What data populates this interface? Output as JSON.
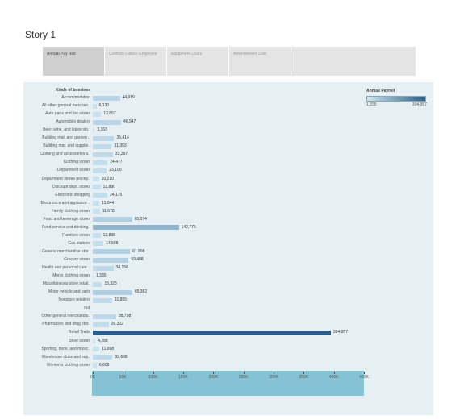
{
  "story_title": "Story 1",
  "tabs": [
    {
      "label": "Annual Pay Roll",
      "active": true
    },
    {
      "label": "Contract Labour Employee",
      "active": false
    },
    {
      "label": "Equipment Costs",
      "active": false
    },
    {
      "label": "Advertisment Cost",
      "active": false
    }
  ],
  "colors": {
    "low": "#cce4f2",
    "high": "#2b5e88",
    "axis_band": "#85c3d4",
    "viz_bg": "#e6eff4"
  },
  "legend": {
    "title": "Annual Payroll",
    "min_label": "1,335",
    "max_label": "394,957"
  },
  "chart_data": {
    "type": "bar",
    "orientation": "horizontal",
    "dimension_header": "Kinds of bussines",
    "xlim": [
      0,
      450000
    ],
    "x_ticks": [
      {
        "value": 0,
        "label": "0K"
      },
      {
        "value": 50000,
        "label": "50K"
      },
      {
        "value": 100000,
        "label": "100K"
      },
      {
        "value": 150000,
        "label": "150K"
      },
      {
        "value": 200000,
        "label": "200K"
      },
      {
        "value": 250000,
        "label": "250K"
      },
      {
        "value": 300000,
        "label": "300K"
      },
      {
        "value": 350000,
        "label": "350K"
      },
      {
        "value": 400000,
        "label": "400K"
      },
      {
        "value": 450000,
        "label": "450K"
      }
    ],
    "categories": [
      "Accommodation",
      "All other general merchan..",
      "Auto parts and tire stores",
      "Automobile dealers",
      "Beer, wine, and liquor sto..",
      "Building mat. and garden ..",
      "Building mat. and supplie..",
      "Clothing and accessories s..",
      "Clothing stores",
      "Department stores",
      "Department stores (excep..",
      "Discount dept. stores",
      "Electronic shopping",
      "Electronics and appliance ..",
      "Family clothing stores",
      "Food and beverage stores",
      "Food service and drinking..",
      "Furniture stores",
      "Gas stations",
      "General merchandise stor..",
      "Grocery stores",
      "Health and personal care ..",
      "Men's clothing stores",
      "Miscellaneous store retail..",
      "Motor vehicle and parts",
      "Nonstore retailers",
      "null",
      "Other general merchandis..",
      "Pharmacies and drug stor..",
      "Retail Trade",
      "Shoe stores",
      "Sporting, book, and music..",
      "Warehouse clubs and sup..",
      "Women's clothing stores"
    ],
    "values": [
      44919,
      6130,
      13857,
      46947,
      3163,
      35414,
      31353,
      33397,
      24477,
      23100,
      10210,
      12890,
      24175,
      11044,
      11678,
      65074,
      142775,
      12898,
      17508,
      61898,
      59408,
      34156,
      1335,
      15325,
      65382,
      31855,
      null,
      38798,
      26322,
      394957,
      4288,
      11008,
      32668,
      6606
    ],
    "value_labels": [
      "44,919",
      "6,130",
      "13,857",
      "46,947",
      "3,163",
      "35,414",
      "31,353",
      "33,397",
      "24,477",
      "23,100",
      "10,210",
      "12,890",
      "24,175",
      "11,044",
      "11,678",
      "65,074",
      "142,775",
      "12,898",
      "17,508",
      "61,898",
      "59,408",
      "34,156",
      "1,335",
      "15,325",
      "65,382",
      "31,855",
      "",
      "38,798",
      "26,322",
      "394,957",
      "4,288",
      "11,008",
      "32,668",
      "6,606"
    ]
  }
}
